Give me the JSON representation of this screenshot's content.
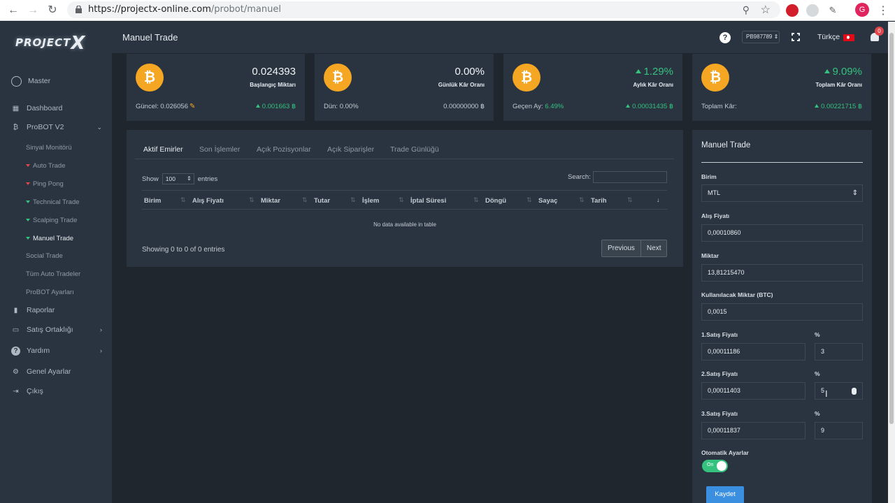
{
  "browser": {
    "url_host": "https://projectx-online.com",
    "url_path": "/probot/manuel",
    "avatar_letter": "G"
  },
  "logo": {
    "text": "PROJECT",
    "mark": "X"
  },
  "sidebar": {
    "user": "Master",
    "items": [
      {
        "label": "Dashboard",
        "icon": "dashboard-icon"
      },
      {
        "label": "ProBOT V2",
        "icon": "bitcoin-icon"
      },
      {
        "label": "Raporlar",
        "icon": "bar-chart-icon"
      },
      {
        "label": "Satış Ortaklığı",
        "icon": "money-icon"
      },
      {
        "label": "Yardım",
        "icon": "question-icon"
      },
      {
        "label": "Genel Ayarlar",
        "icon": "gear-icon"
      },
      {
        "label": "Çıkış",
        "icon": "logout-icon"
      }
    ],
    "probot_sub": [
      {
        "label": "Sinyal Monitörü"
      },
      {
        "label": "Auto Trade"
      },
      {
        "label": "Ping Pong"
      },
      {
        "label": "Technical Trade"
      },
      {
        "label": "Scalping Trade"
      },
      {
        "label": "Manuel Trade"
      },
      {
        "label": "Social Trade"
      },
      {
        "label": "Tüm Auto Tradeler"
      },
      {
        "label": "ProBOT Ayarları"
      }
    ]
  },
  "topbar": {
    "title": "Manuel Trade",
    "account": "PB987789",
    "language": "Türkçe",
    "notifications": "0"
  },
  "cards": [
    {
      "value": "0.024393",
      "caption": "Başlangıç Miktarı",
      "foot_left": "Güncel: 0.026056",
      "foot_right": "0.001663 ฿"
    },
    {
      "value": "0.00%",
      "caption": "Günlük Kâr Oranı",
      "foot_left": "Dün: 0.00%",
      "foot_right": "0.00000000 ฿"
    },
    {
      "value": "1.29%",
      "caption": "Aylık Kâr Oranı",
      "foot_left_label": "Geçen Ay:",
      "foot_left_value": "6.49%",
      "foot_right": "0.00031435 ฿"
    },
    {
      "value": "9.09%",
      "caption": "Toplam Kâr Oranı",
      "foot_left": "Toplam Kâr:",
      "foot_right": "0.00221715 ฿"
    }
  ],
  "orders": {
    "tabs": [
      "Aktif Emirler",
      "Son İşlemler",
      "Açık Pozisyonlar",
      "Açık Siparişler",
      "Trade Günlüğü"
    ],
    "show_label": "Show",
    "entries_count": "100",
    "entries_label": "entries",
    "search_label": "Search:",
    "columns": [
      "Birim",
      "Alış Fiyatı",
      "Miktar",
      "Tutar",
      "İşlem",
      "İptal Süresi",
      "Döngü",
      "Sayaç",
      "Tarih"
    ],
    "empty_message": "No data available in table",
    "showing": "Showing 0 to 0 of 0 entries",
    "prev_label": "Previous",
    "next_label": "Next"
  },
  "form": {
    "title": "Manuel Trade",
    "birim_label": "Birim",
    "birim_value": "MTL",
    "alis_label": "Alış Fiyatı",
    "alis_value": "0,00010860",
    "miktar_label": "Miktar",
    "miktar_value": "13,81215470",
    "kullan_label": "Kullanılacak Miktar (BTC)",
    "kullan_value": "0,0015",
    "percent_label": "%",
    "sells": [
      {
        "label": "1.Satış Fiyatı",
        "value": "0,00011186",
        "percent": "3"
      },
      {
        "label": "2.Satış Fiyatı",
        "value": "0,00011403",
        "percent": "5"
      },
      {
        "label": "3.Satış Fiyatı",
        "value": "0,00011837",
        "percent": "9"
      }
    ],
    "auto_label": "Otomatik Ayarlar",
    "auto_state": "On",
    "save_label": "Kaydet"
  }
}
